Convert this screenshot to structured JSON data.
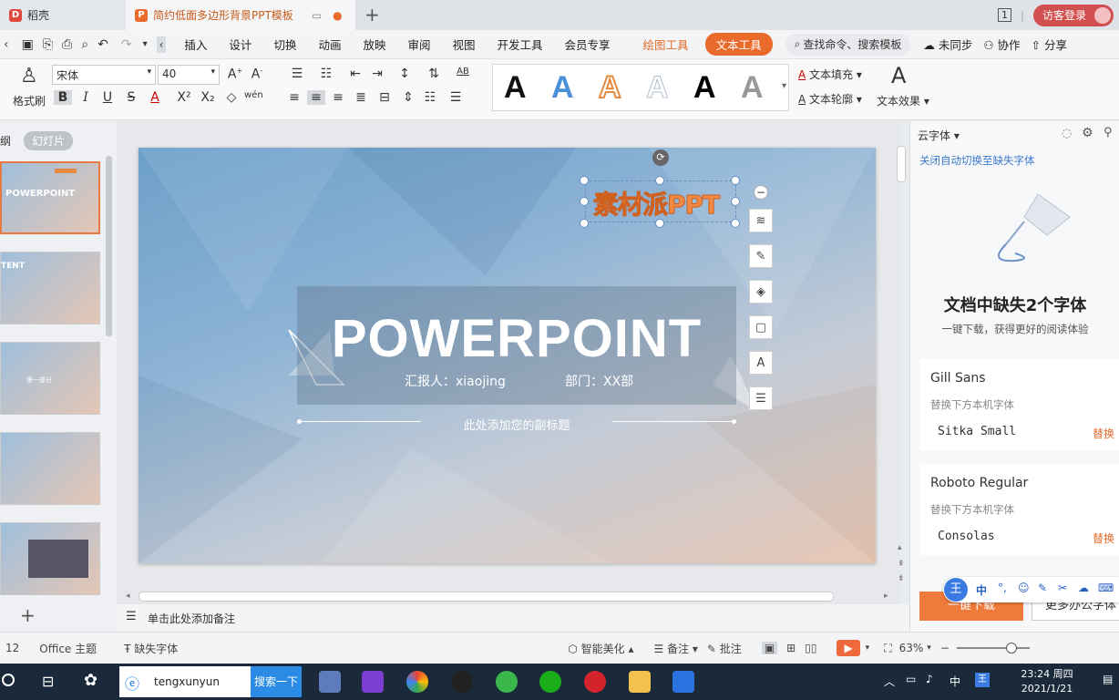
{
  "titlebar": {
    "app_tab": "稻壳",
    "doc_tab": "简约低面多边形背景PPT模板",
    "page_badge": "1",
    "login": "访客登录"
  },
  "menu": {
    "items": [
      "插入",
      "设计",
      "切换",
      "动画",
      "放映",
      "审阅",
      "视图",
      "开发工具",
      "会员专享"
    ],
    "drawing_tools": "绘图工具",
    "text_tools": "文本工具",
    "search": "查找命令、搜索模板",
    "sync": "未同步",
    "collab": "协作",
    "share": "分享"
  },
  "ribbon": {
    "format_painter": "格式刷",
    "font_name": "宋体",
    "font_size": "40",
    "text_fill": "文本填充",
    "text_outline": "文本轮廓",
    "text_effect": "文本效果",
    "gallery_letter": "A"
  },
  "leftpanel": {
    "tab_outline": "纲",
    "tab_slides": "幻灯片",
    "thumb1_text": "POWERPOINT",
    "thumb2_text": "TENT",
    "thumb3_text": "第一部分"
  },
  "slide": {
    "watermark": "素材派PPT",
    "title": "POWERPOINT",
    "reporter": "汇报人：xiaojing",
    "dept": "部门：XX部",
    "subtitle": "此处添加您的副标题"
  },
  "notes": {
    "placeholder": "单击此处添加备注"
  },
  "rightpanel": {
    "header": "云字体",
    "link": "关闭自动切换至缺失字体",
    "missing_title": "文档中缺失2个字体",
    "missing_sub": "一键下载，获得更好的阅读体验",
    "fonts": [
      {
        "name": "Gill Sans",
        "hint": "替换下方本机字体",
        "replace": "Sitka Small",
        "action": "替换"
      },
      {
        "name": "Roboto Regular",
        "hint": "替换下方本机字体",
        "replace": "Consolas",
        "action": "替换"
      }
    ],
    "download": "一键下载",
    "more": "更多办公字体"
  },
  "status": {
    "page": "12",
    "theme": "Office 主题",
    "missing_font": "缺失字体",
    "smart": "智能美化",
    "notes": "备注",
    "comment": "批注",
    "zoom": "63%"
  },
  "ime": {
    "label": "中"
  },
  "taskbar": {
    "search_text": "tengxunyun",
    "search_btn": "搜索一下",
    "lang": "中",
    "time": "23:24 周四",
    "date": "2021/1/21"
  }
}
